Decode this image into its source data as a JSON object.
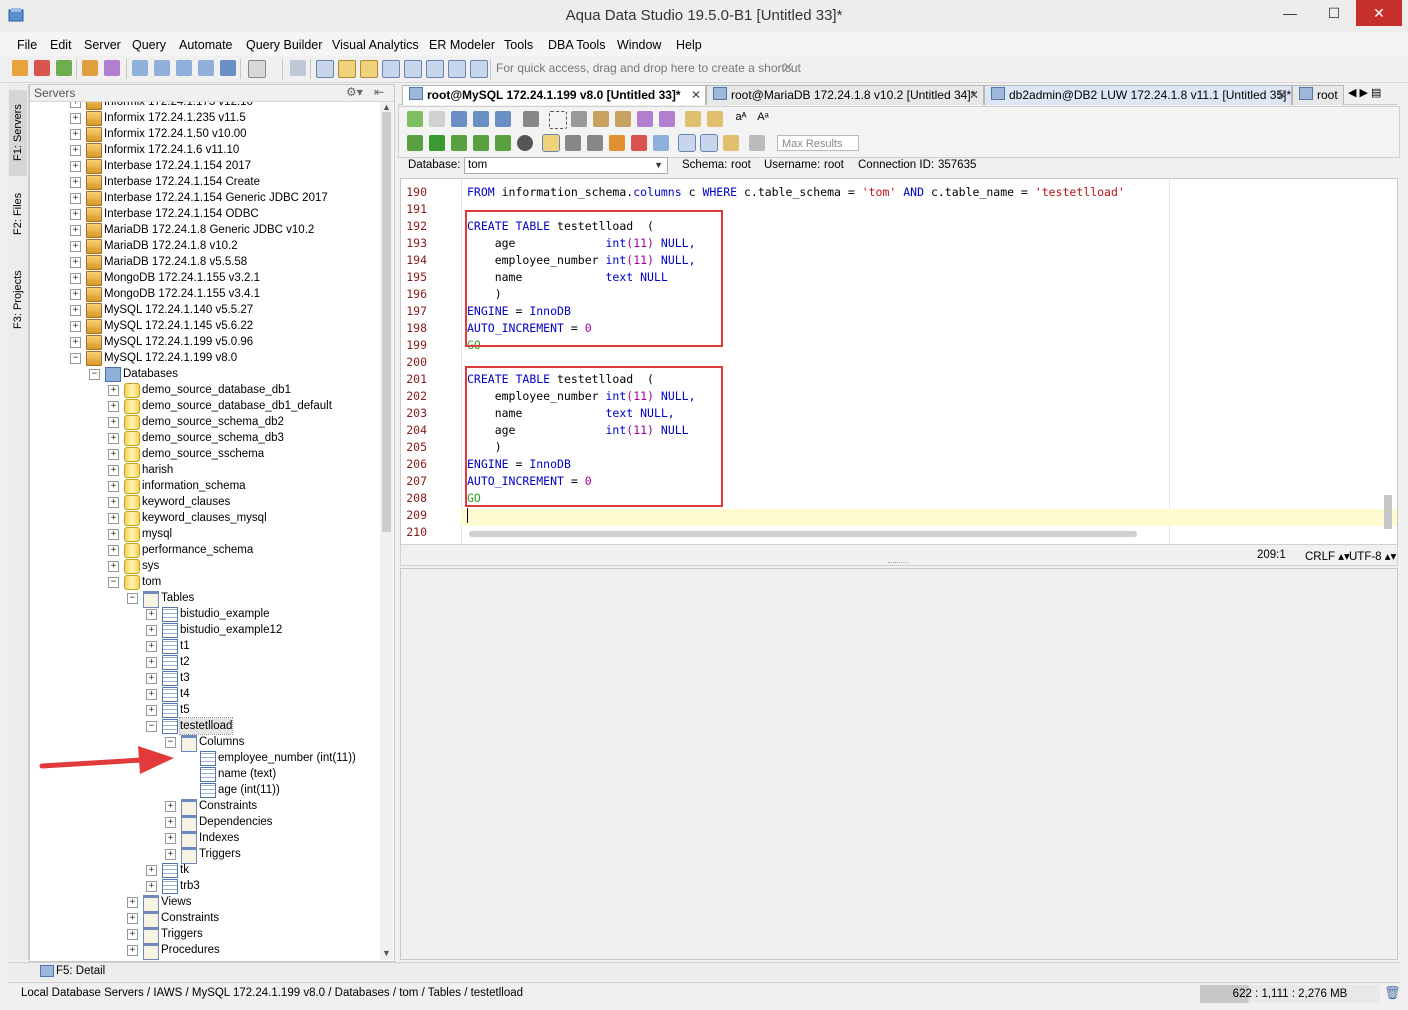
{
  "window": {
    "title": "Aqua Data Studio 19.5.0-B1 [Untitled 33]*",
    "minimize": "—",
    "maximize": "☐",
    "close": "✕"
  },
  "menu": [
    "File",
    "Edit",
    "Server",
    "Query",
    "Automate",
    "Query Builder",
    "Visual Analytics",
    "ER Modeler",
    "Tools",
    "DBA Tools",
    "Window",
    "Help"
  ],
  "toolbar": {
    "shortcut_hint": "For quick access, drag and drop here to create a shortcut",
    "hint_close": "✕"
  },
  "side_tabs": {
    "servers": "F1: Servers",
    "files": "F2: Files",
    "projects": "F3: Projects"
  },
  "servers_panel": {
    "title": "Servers",
    "gear": "⚙▾",
    "pin": "⇤"
  },
  "tree": {
    "top_partial": "Informix 172.24.1.175 v12.10",
    "servers": [
      "Informix 172.24.1.235 v11.5",
      "Informix 172.24.1.50 v10.00",
      "Informix 172.24.1.6 v11.10",
      "Interbase 172.24.1.154 2017",
      "Interbase 172.24.1.154 Create",
      "Interbase 172.24.1.154 Generic JDBC 2017",
      "Interbase 172.24.1.154 ODBC",
      "MariaDB 172.24.1.8 Generic JDBC v10.2",
      "MariaDB 172.24.1.8 v10.2",
      "MariaDB 172.24.1.8 v5.5.58",
      "MongoDB 172.24.1.155 v3.2.1",
      "MongoDB 172.24.1.155 v3.4.1",
      "MySQL 172.24.1.140 v5.5.27",
      "MySQL 172.24.1.145 v5.6.22",
      "MySQL 172.24.1.199 v5.0.96",
      "MySQL 172.24.1.199 v8.0"
    ],
    "databases_label": "Databases",
    "databases": [
      "demo_source_database_db1",
      "demo_source_database_db1_default",
      "demo_source_schema_db2",
      "demo_source_schema_db3",
      "demo_source_sschema",
      "harish",
      "information_schema",
      "keyword_clauses",
      "keyword_clauses_mysql",
      "mysql",
      "performance_schema",
      "sys",
      "tom"
    ],
    "tables_label": "Tables",
    "tables": [
      "bistudio_example",
      "bistudio_example12",
      "t1",
      "t2",
      "t3",
      "t4",
      "t5"
    ],
    "selected_table": "testetlload",
    "columns_label": "Columns",
    "columns": [
      "employee_number (int(11))",
      "name (text)",
      "age (int(11))"
    ],
    "table_children": [
      "Constraints",
      "Dependencies",
      "Indexes",
      "Triggers"
    ],
    "tables_after": [
      "tk",
      "trb3"
    ],
    "db_children": [
      "Views",
      "Constraints",
      "Triggers",
      "Procedures"
    ]
  },
  "tabs": [
    {
      "label": "root@MySQL 172.24.1.199 v8.0 [Untitled 33]*",
      "active": true
    },
    {
      "label": "root@MariaDB 172.24.1.8 v10.2 [Untitled 34]*",
      "active": false
    },
    {
      "label": "db2admin@DB2 LUW 172.24.1.8 v11.1 [Untitled 35]*",
      "active": false
    },
    {
      "label": "root",
      "active": false
    }
  ],
  "tab_close": "✕",
  "tab_nav": "◀ ▶ ▤",
  "editor_toolbar": {
    "max_results_placeholder": "Max Results"
  },
  "connection": {
    "database_label": "Database:",
    "database_value": "tom",
    "schema_label": "Schema:",
    "schema_value": "root",
    "username_label": "Username:",
    "username_value": "root",
    "connection_id_label": "Connection ID:",
    "connection_id_value": "357635"
  },
  "code": {
    "line_numbers": [
      "190",
      "191",
      "192",
      "193",
      "194",
      "195",
      "196",
      "197",
      "198",
      "199",
      "200",
      "201",
      "202",
      "203",
      "204",
      "205",
      "206",
      "207",
      "208",
      "209",
      "210"
    ],
    "line190": {
      "from": "FROM",
      "t1": " information_schema.",
      "col": "columns",
      "t2": " c ",
      "where": "WHERE",
      "t3": " c.table_schema = ",
      "s1": "'tom'",
      "t4": " ",
      "and": "AND",
      "t5": " c.table_name = ",
      "s2": "'testetlload'"
    },
    "create": "CREATE",
    "table": "TABLE",
    "table_name": " testetlload  (",
    "engine": "ENGINE",
    "eq": " = ",
    "innodb": "InnoDB",
    "auto_inc": "AUTO_INCREMENT",
    "zero": "0",
    "go": "GO",
    "close_paren": "    )",
    "block1": [
      {
        "name": "    age             ",
        "type": "int",
        "size": "(11)",
        "tail": " NULL,"
      },
      {
        "name": "    employee_number ",
        "type": "int",
        "size": "(11)",
        "tail": " NULL,"
      },
      {
        "name": "    name            ",
        "type": "text",
        "size": "",
        "tail": " NULL"
      }
    ],
    "block2": [
      {
        "name": "    employee_number ",
        "type": "int",
        "size": "(11)",
        "tail": " NULL,"
      },
      {
        "name": "    name            ",
        "type": "text",
        "size": "",
        "tail": " NULL,"
      },
      {
        "name": "    age             ",
        "type": "int",
        "size": "(11)",
        "tail": " NULL"
      }
    ]
  },
  "editor_status": {
    "position": "209:1",
    "line_ending": "CRLF",
    "encoding": "UTF-8"
  },
  "detail_bar": {
    "label": "F5: Detail"
  },
  "status_bar": {
    "path": "Local Database Servers / IAWS / MySQL 172.24.1.199 v8.0 / Databases / tom / Tables / testetlload",
    "memory": "622 : 1,111 : 2,276 MB",
    "trash": "🗑",
    "memory_used_fraction": 0.27
  },
  "colors": {
    "keyword": "#0000c8",
    "string": "#c01010",
    "number": "#a000a0",
    "go": "#2aa02a",
    "highlight_box": "#e03a3a",
    "arrow": "#e03a3a"
  }
}
